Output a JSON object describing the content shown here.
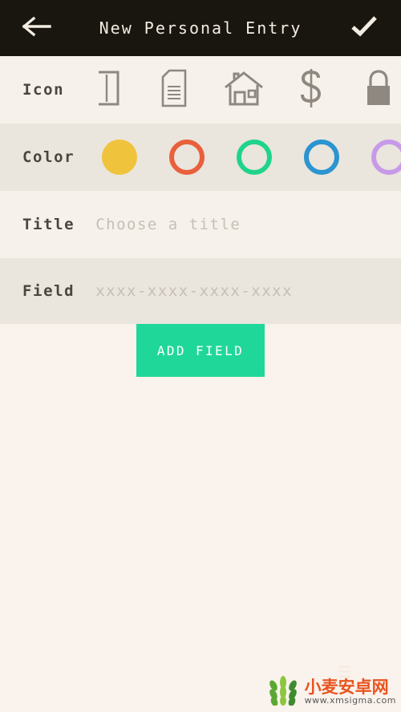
{
  "appbar": {
    "back_icon": "arrow-left-icon",
    "title": "New Personal Entry",
    "confirm_icon": "check-icon",
    "bg": "#19150f",
    "fg": "#f2ece2"
  },
  "rows": {
    "icon": {
      "label": "Icon",
      "icons": [
        {
          "name": "card-icon",
          "selected": false
        },
        {
          "name": "document-icon",
          "selected": false
        },
        {
          "name": "home-icon",
          "selected": false
        },
        {
          "name": "dollar-icon",
          "selected": false
        },
        {
          "name": "lock-icon",
          "selected": false
        }
      ],
      "icon_color": "#8e8880"
    },
    "color": {
      "label": "Color",
      "swatches": [
        {
          "name": "color-swatch-yellow",
          "color": "#f0c33c",
          "selected": true
        },
        {
          "name": "color-swatch-red",
          "color": "#e8603c",
          "selected": false
        },
        {
          "name": "color-swatch-green",
          "color": "#1fd48a",
          "selected": false
        },
        {
          "name": "color-swatch-blue",
          "color": "#2a95d0",
          "selected": false
        },
        {
          "name": "color-swatch-purple",
          "color": "#c79ae8",
          "selected": false
        }
      ]
    },
    "title": {
      "label": "Title",
      "value": "",
      "placeholder": "Choose a title"
    },
    "field": {
      "label": "Field",
      "value": "",
      "placeholder": "xxxx-xxxx-xxxx-xxxx"
    }
  },
  "add_field_button": {
    "label": "ADD FIELD",
    "color": "#20d79a"
  },
  "fab": {
    "glyph": "☰"
  },
  "watermark": {
    "cn": "小麦安卓网",
    "url": "www.xmsigma.com"
  }
}
